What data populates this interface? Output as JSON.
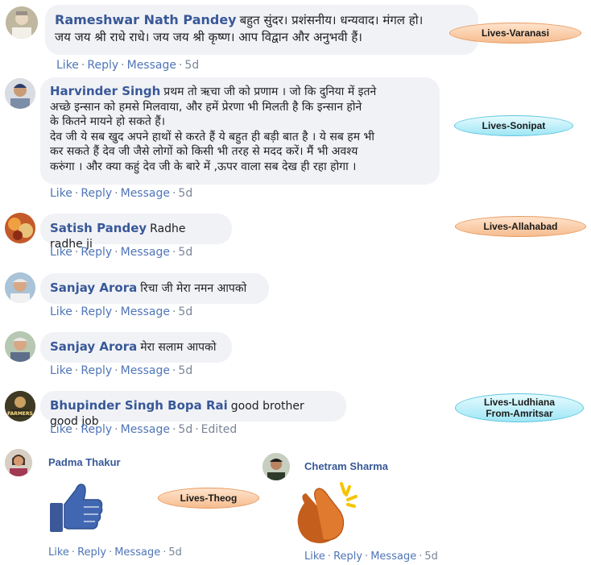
{
  "actions": {
    "like": "Like",
    "reply": "Reply",
    "message": "Message",
    "sep": "·",
    "edited": "Edited"
  },
  "comments": [
    {
      "name": "Rameshwar Nath Pandey",
      "text": "बहुत सुंदर। प्रशंसनीय। धन्यवाद। मंगल हो।\nजय जय श्री राधे राधे। जय जय श्री कृष्ण। आप विद्वान और अनुभवी हैं।",
      "time": "5d"
    },
    {
      "name": "Harvinder Singh",
      "text": "प्रथम तो ऋचा जी को प्रणाम । जो कि दुनिया में इतने\nअच्छे इन्सान को हमसे मिलवाया, और हमें प्रेरणा भी मिलती है कि इन्सान होने\nके कितने मायने हो सकते हैं।\nदेव जी ये सब खुद अपने हाथों से करते हैं ये बहुत ही बड़ी बात है । ये सब हम भी\nकर सकते हैं देव जी जैसे लोगों को किसी भी तरह से मदद करें। मैं भी अवश्य\nकरुंगा । और क्या कहुं देव जी के बारे में ,ऊपर वाला सब देख ही रहा होगा ।",
      "time": "5d"
    },
    {
      "name": "Satish Pandey",
      "text": "Radhe radhe ji",
      "time": "5d"
    },
    {
      "name": "Sanjay Arora",
      "text": "रिचा जी मेरा नमन आपको",
      "time": "5d"
    },
    {
      "name": "Sanjay Arora",
      "text": "मेरा सलाम आपको",
      "time": "5d"
    },
    {
      "name": "Bhupinder Singh Bopa Rai",
      "text": "good brother good job",
      "time": "5d",
      "edited": true
    }
  ],
  "stickers": [
    {
      "name": "Padma Thakur",
      "time": "5d"
    },
    {
      "name": "Chetram Sharma",
      "time": "5d"
    }
  ],
  "tags": [
    "Lives-Varanasi",
    "Lives-Sonipat",
    "Lives-Allahabad",
    "Lives-Ludhiana",
    "From-Amritsar",
    "Lives-Theog"
  ],
  "avatar_badge": "FARMERS",
  "colors": {
    "name": "#385898",
    "link": "#4f75b8",
    "bubble": "#f1f2f6",
    "tag_orange": "#f6bd8f",
    "tag_blue": "#9fe6f5",
    "like_blue": "#3b5998",
    "clap": "#d2691e",
    "spark": "#f5c400"
  }
}
